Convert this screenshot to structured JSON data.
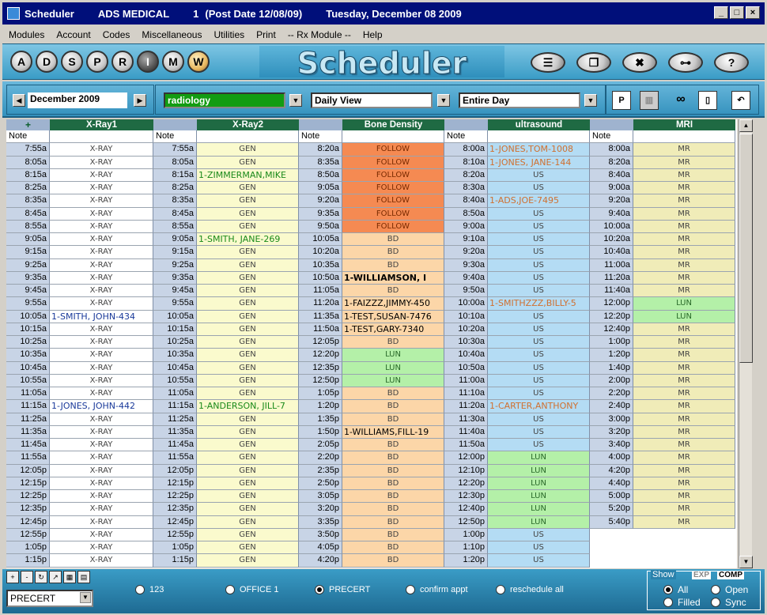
{
  "title_bar": {
    "app": "Scheduler",
    "org": "ADS MEDICAL",
    "session": "1",
    "post_date": "(Post Date 12/08/09)",
    "date": "Tuesday, December 08 2009"
  },
  "menu": [
    "Modules",
    "Account",
    "Codes",
    "Miscellaneous",
    "Utilities",
    "Print",
    "-- Rx Module --",
    "Help"
  ],
  "letter_buttons": [
    "A",
    "D",
    "S",
    "P",
    "R",
    "I",
    "M",
    "W"
  ],
  "app_name": "Scheduler",
  "nav": {
    "month": "December 2009",
    "department": "radiology",
    "view": "Daily View",
    "range": "Entire Day"
  },
  "grid": {
    "time_header": "+",
    "note_label": "Note",
    "columns": [
      {
        "name": "X-Ray1",
        "bg": "#ffffff",
        "times": [
          "7:55a",
          "8:05a",
          "8:15a",
          "8:25a",
          "8:35a",
          "8:45a",
          "8:55a",
          "9:05a",
          "9:15a",
          "9:25a",
          "9:35a",
          "9:45a",
          "9:55a",
          "10:05a",
          "10:15a",
          "10:25a",
          "10:35a",
          "10:45a",
          "10:55a",
          "11:05a",
          "11:15a",
          "11:25a",
          "11:35a",
          "11:45a",
          "11:55a",
          "12:05p",
          "12:15p",
          "12:25p",
          "12:35p",
          "12:45p",
          "12:55p",
          "1:05p",
          "1:15p"
        ],
        "appts": [
          [
            "X-RAY",
            ""
          ],
          [
            "X-RAY",
            ""
          ],
          [
            "X-RAY",
            ""
          ],
          [
            "X-RAY",
            ""
          ],
          [
            "X-RAY",
            ""
          ],
          [
            "X-RAY",
            ""
          ],
          [
            "X-RAY",
            ""
          ],
          [
            "X-RAY",
            ""
          ],
          [
            "X-RAY",
            ""
          ],
          [
            "X-RAY",
            ""
          ],
          [
            "X-RAY",
            ""
          ],
          [
            "X-RAY",
            ""
          ],
          [
            "X-RAY",
            ""
          ],
          [
            "1-SMITH, JOHN-434",
            "name-blue"
          ],
          [
            "X-RAY",
            ""
          ],
          [
            "X-RAY",
            ""
          ],
          [
            "X-RAY",
            ""
          ],
          [
            "X-RAY",
            ""
          ],
          [
            "X-RAY",
            ""
          ],
          [
            "X-RAY",
            ""
          ],
          [
            "1-JONES, JOHN-442",
            "name-blue"
          ],
          [
            "X-RAY",
            ""
          ],
          [
            "X-RAY",
            ""
          ],
          [
            "X-RAY",
            ""
          ],
          [
            "X-RAY",
            ""
          ],
          [
            "X-RAY",
            ""
          ],
          [
            "X-RAY",
            ""
          ],
          [
            "X-RAY",
            ""
          ],
          [
            "X-RAY",
            ""
          ],
          [
            "X-RAY",
            ""
          ],
          [
            "X-RAY",
            ""
          ],
          [
            "X-RAY",
            ""
          ],
          [
            "X-RAY",
            ""
          ]
        ]
      },
      {
        "name": "X-Ray2",
        "bg": "#fafacd",
        "times": [
          "7:55a",
          "8:05a",
          "8:15a",
          "8:25a",
          "8:35a",
          "8:45a",
          "8:55a",
          "9:05a",
          "9:15a",
          "9:25a",
          "9:35a",
          "9:45a",
          "9:55a",
          "10:05a",
          "10:15a",
          "10:25a",
          "10:35a",
          "10:45a",
          "10:55a",
          "11:05a",
          "11:15a",
          "11:25a",
          "11:35a",
          "11:45a",
          "11:55a",
          "12:05p",
          "12:15p",
          "12:25p",
          "12:35p",
          "12:45p",
          "12:55p",
          "1:05p",
          "1:15p"
        ],
        "appts": [
          [
            "GEN",
            ""
          ],
          [
            "GEN",
            ""
          ],
          [
            "1-ZIMMERMAN,MIKE",
            "name-green"
          ],
          [
            "GEN",
            ""
          ],
          [
            "GEN",
            ""
          ],
          [
            "GEN",
            ""
          ],
          [
            "GEN",
            ""
          ],
          [
            "1-SMITH, JANE-269",
            "name-green"
          ],
          [
            "GEN",
            ""
          ],
          [
            "GEN",
            ""
          ],
          [
            "GEN",
            ""
          ],
          [
            "GEN",
            ""
          ],
          [
            "GEN",
            ""
          ],
          [
            "GEN",
            ""
          ],
          [
            "GEN",
            ""
          ],
          [
            "GEN",
            ""
          ],
          [
            "GEN",
            ""
          ],
          [
            "GEN",
            ""
          ],
          [
            "GEN",
            ""
          ],
          [
            "GEN",
            ""
          ],
          [
            "1-ANDERSON, JILL-7",
            "name-green"
          ],
          [
            "GEN",
            ""
          ],
          [
            "GEN",
            ""
          ],
          [
            "GEN",
            ""
          ],
          [
            "GEN",
            ""
          ],
          [
            "GEN",
            ""
          ],
          [
            "GEN",
            ""
          ],
          [
            "GEN",
            ""
          ],
          [
            "GEN",
            ""
          ],
          [
            "GEN",
            ""
          ],
          [
            "GEN",
            ""
          ],
          [
            "GEN",
            ""
          ],
          [
            "GEN",
            ""
          ]
        ]
      },
      {
        "name": "Bone Density",
        "bg": "#fcd6a8",
        "times": [
          "8:20a",
          "8:35a",
          "8:50a",
          "9:05a",
          "9:20a",
          "9:35a",
          "9:50a",
          "10:05a",
          "10:20a",
          "10:35a",
          "10:50a",
          "11:05a",
          "11:20a",
          "11:35a",
          "11:50a",
          "12:05p",
          "12:20p",
          "12:35p",
          "12:50p",
          "1:05p",
          "1:20p",
          "1:35p",
          "1:50p",
          "2:05p",
          "2:20p",
          "2:35p",
          "2:50p",
          "3:05p",
          "3:20p",
          "3:35p",
          "3:50p",
          "4:05p",
          "4:20p"
        ],
        "appts": [
          [
            "FOLLOW",
            "follow"
          ],
          [
            "FOLLOW",
            "follow"
          ],
          [
            "FOLLOW",
            "follow"
          ],
          [
            "FOLLOW",
            "follow"
          ],
          [
            "FOLLOW",
            "follow"
          ],
          [
            "FOLLOW",
            "follow"
          ],
          [
            "FOLLOW",
            "follow"
          ],
          [
            "BD",
            ""
          ],
          [
            "BD",
            ""
          ],
          [
            "BD",
            ""
          ],
          [
            "1-WILLIAMSON, I",
            "name-bold"
          ],
          [
            "BD",
            ""
          ],
          [
            "1-FAIZZZ,JIMMY-450",
            "name-black"
          ],
          [
            "1-TEST,SUSAN-7476",
            "name-black"
          ],
          [
            "1-TEST,GARY-7340",
            "name-black"
          ],
          [
            "BD",
            ""
          ],
          [
            "LUN",
            "lun"
          ],
          [
            "LUN",
            "lun"
          ],
          [
            "LUN",
            "lun"
          ],
          [
            "BD",
            ""
          ],
          [
            "BD",
            ""
          ],
          [
            "BD",
            ""
          ],
          [
            "1-WILLIAMS,FILL-19",
            "name-black"
          ],
          [
            "BD",
            ""
          ],
          [
            "BD",
            ""
          ],
          [
            "BD",
            ""
          ],
          [
            "BD",
            ""
          ],
          [
            "BD",
            ""
          ],
          [
            "BD",
            ""
          ],
          [
            "BD",
            ""
          ],
          [
            "BD",
            ""
          ],
          [
            "BD",
            ""
          ],
          [
            "BD",
            ""
          ]
        ]
      },
      {
        "name": "ultrasound",
        "bg": "#b4dcf4",
        "times": [
          "8:00a",
          "8:10a",
          "8:20a",
          "8:30a",
          "8:40a",
          "8:50a",
          "9:00a",
          "9:10a",
          "9:20a",
          "9:30a",
          "9:40a",
          "9:50a",
          "10:00a",
          "10:10a",
          "10:20a",
          "10:30a",
          "10:40a",
          "10:50a",
          "11:00a",
          "11:10a",
          "11:20a",
          "11:30a",
          "11:40a",
          "11:50a",
          "12:00p",
          "12:10p",
          "12:20p",
          "12:30p",
          "12:40p",
          "12:50p",
          "1:00p",
          "1:10p",
          "1:20p"
        ],
        "appts": [
          [
            "1-JONES,TOM-1008",
            "name-orange"
          ],
          [
            "1-JONES, JANE-144",
            "name-orange"
          ],
          [
            "US",
            ""
          ],
          [
            "US",
            ""
          ],
          [
            "1-ADS,JOE-7495",
            "name-orange"
          ],
          [
            "US",
            ""
          ],
          [
            "US",
            ""
          ],
          [
            "US",
            ""
          ],
          [
            "US",
            ""
          ],
          [
            "US",
            ""
          ],
          [
            "US",
            ""
          ],
          [
            "US",
            ""
          ],
          [
            "1-SMITHZZZ,BILLY-5",
            "name-orange"
          ],
          [
            "US",
            ""
          ],
          [
            "US",
            ""
          ],
          [
            "US",
            ""
          ],
          [
            "US",
            ""
          ],
          [
            "US",
            ""
          ],
          [
            "US",
            ""
          ],
          [
            "US",
            ""
          ],
          [
            "1-CARTER,ANTHONY",
            "name-orange"
          ],
          [
            "US",
            ""
          ],
          [
            "US",
            ""
          ],
          [
            "US",
            ""
          ],
          [
            "LUN",
            "lun"
          ],
          [
            "LUN",
            "lun"
          ],
          [
            "LUN",
            "lun"
          ],
          [
            "LUN",
            "lun"
          ],
          [
            "LUN",
            "lun"
          ],
          [
            "LUN",
            "lun"
          ],
          [
            "US",
            ""
          ],
          [
            "US",
            ""
          ],
          [
            "US",
            ""
          ]
        ]
      },
      {
        "name": "MRI",
        "bg": "#f0ecb8",
        "times": [
          "8:00a",
          "8:20a",
          "8:40a",
          "9:00a",
          "9:20a",
          "9:40a",
          "10:00a",
          "10:20a",
          "10:40a",
          "11:00a",
          "11:20a",
          "11:40a",
          "12:00p",
          "12:20p",
          "12:40p",
          "1:00p",
          "1:20p",
          "1:40p",
          "2:00p",
          "2:20p",
          "2:40p",
          "3:00p",
          "3:20p",
          "3:40p",
          "4:00p",
          "4:20p",
          "4:40p",
          "5:00p",
          "5:20p",
          "5:40p"
        ],
        "appts": [
          [
            "MR",
            ""
          ],
          [
            "MR",
            ""
          ],
          [
            "MR",
            ""
          ],
          [
            "MR",
            ""
          ],
          [
            "MR",
            ""
          ],
          [
            "MR",
            ""
          ],
          [
            "MR",
            ""
          ],
          [
            "MR",
            ""
          ],
          [
            "MR",
            ""
          ],
          [
            "MR",
            ""
          ],
          [
            "MR",
            ""
          ],
          [
            "MR",
            ""
          ],
          [
            "LUN",
            "lun"
          ],
          [
            "LUN",
            "lun"
          ],
          [
            "MR",
            ""
          ],
          [
            "MR",
            ""
          ],
          [
            "MR",
            ""
          ],
          [
            "MR",
            ""
          ],
          [
            "MR",
            ""
          ],
          [
            "MR",
            ""
          ],
          [
            "MR",
            ""
          ],
          [
            "MR",
            ""
          ],
          [
            "MR",
            ""
          ],
          [
            "MR",
            ""
          ],
          [
            "MR",
            ""
          ],
          [
            "MR",
            ""
          ],
          [
            "MR",
            ""
          ],
          [
            "MR",
            ""
          ],
          [
            "MR",
            ""
          ],
          [
            "MR",
            ""
          ]
        ]
      }
    ]
  },
  "bottom": {
    "precert_select": "PRECERT",
    "radios": [
      {
        "label": "123",
        "selected": false
      },
      {
        "label": "OFFICE 1",
        "selected": false
      },
      {
        "label": "PRECERT",
        "selected": true
      },
      {
        "label": "confirm appt",
        "selected": false
      },
      {
        "label": "reschedule all",
        "selected": false
      }
    ],
    "show_label": "Show",
    "show_tags": [
      "EXP",
      "COMP"
    ],
    "show_options": [
      {
        "label": "All",
        "selected": true
      },
      {
        "label": "Open",
        "selected": false
      },
      {
        "label": "Filled",
        "selected": false
      },
      {
        "label": "Sync",
        "selected": false
      }
    ]
  },
  "colors": {
    "follow": "#f58a52",
    "lun": "#b4f0a8",
    "name_blue": "#1a3a9a",
    "name_green": "#1a8a1a",
    "name_orange": "#d07030",
    "header_green": "#1f6a43"
  }
}
